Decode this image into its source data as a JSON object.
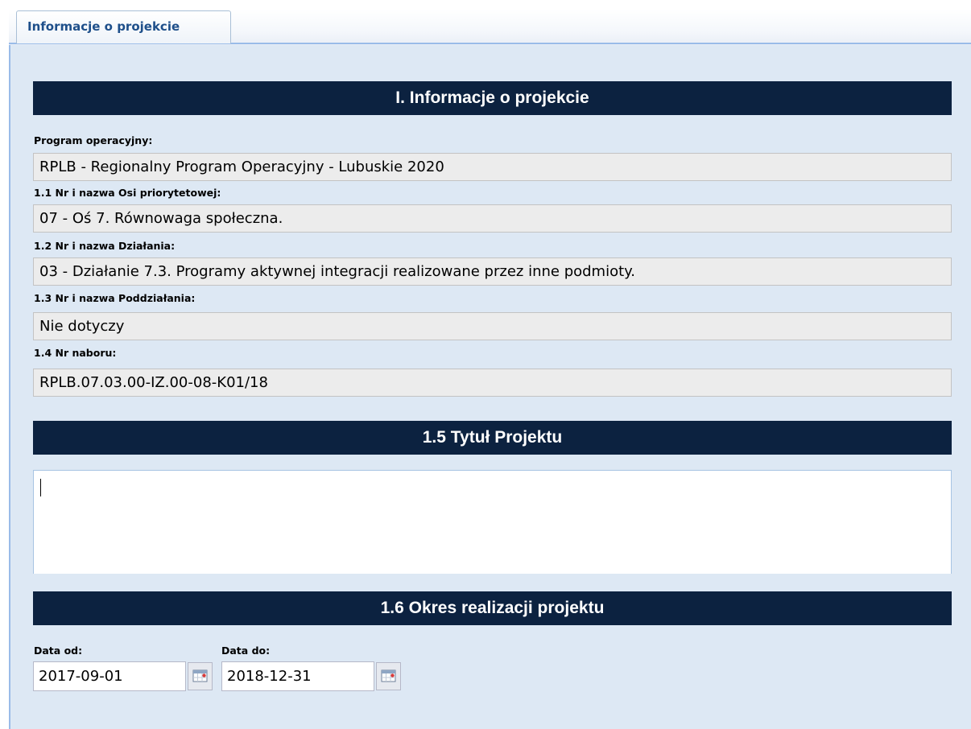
{
  "tab": {
    "label": "Informacje o projekcie"
  },
  "section1": {
    "title": "I. Informacje o projekcie",
    "fields": [
      {
        "label": "Program operacyjny:",
        "value": "RPLB - Regionalny Program Operacyjny - Lubuskie 2020"
      },
      {
        "label": "1.1 Nr i nazwa Osi priorytetowej:",
        "value": "07 - Oś 7. Równowaga społeczna."
      },
      {
        "label": "1.2 Nr i nazwa Działania:",
        "value": "03 - Działanie 7.3. Programy aktywnej integracji realizowane przez inne podmioty."
      },
      {
        "label": "1.3 Nr i nazwa Poddziałania:",
        "value": "Nie dotyczy"
      },
      {
        "label": "1.4 Nr naboru:",
        "value": "RPLB.07.03.00-IZ.00-08-K01/18"
      }
    ]
  },
  "section2": {
    "title": "1.5 Tytuł Projektu",
    "value": ""
  },
  "section3": {
    "title": "1.6 Okres realizacji projektu",
    "date_from_label": "Data od:",
    "date_from": "2017-09-01",
    "date_to_label": "Data do:",
    "date_to": "2018-12-31"
  },
  "icons": {
    "date_picker": "calendar-icon"
  },
  "colors": {
    "header_bg": "#0c2240",
    "panel_bg": "#dde8f4",
    "tab_text": "#1e4f8a",
    "readonly_bg": "#ececec"
  }
}
